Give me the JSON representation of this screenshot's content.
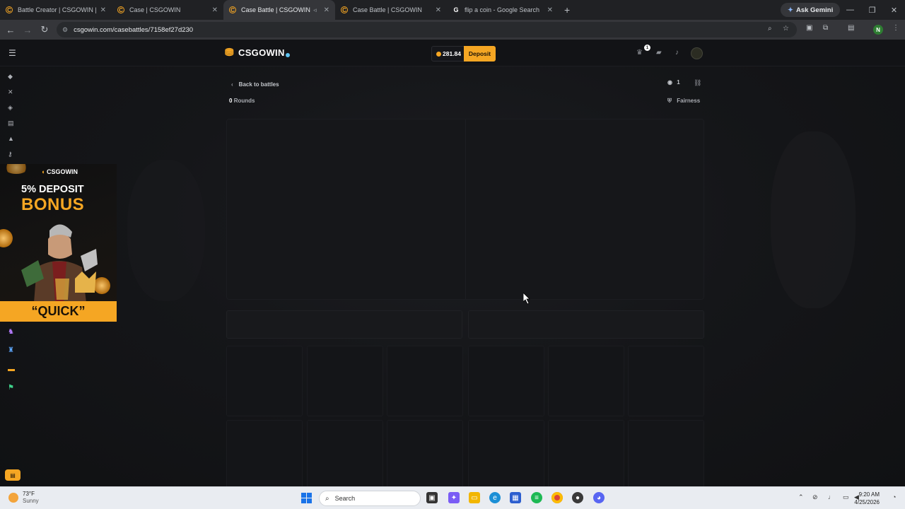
{
  "browser": {
    "tabs": [
      {
        "title": "Battle Creator | CSGOWIN | De",
        "icon": "csgowin-icon",
        "active": false
      },
      {
        "title": "Case | CSGOWIN",
        "icon": "csgowin-icon",
        "active": false
      },
      {
        "title": "Case Battle | CSGOWIN",
        "icon": "csgowin-icon",
        "active": true
      },
      {
        "title": "Case Battle | CSGOWIN",
        "icon": "csgowin-icon",
        "active": false
      },
      {
        "title": "flip a coin - Google Search",
        "icon": "google-icon",
        "active": false
      }
    ],
    "ask_gemini": "Ask Gemini",
    "url": "csgowin.com/casebattles/7158ef27d230",
    "profile_initial": "N"
  },
  "site": {
    "logo_text": "CSGOWIN",
    "balance": "281.84",
    "deposit_label": "Deposit",
    "notification_count": "1"
  },
  "battle": {
    "back_label": "Back to battles",
    "viewers": "1",
    "rounds_count": "0",
    "rounds_label": "Rounds",
    "fairness_label": "Fairness"
  },
  "promo": {
    "logo_text": "CSGOWIN",
    "line1": "5% DEPOSIT",
    "line2": "BONUS",
    "line3": "“QUICK”"
  },
  "taskbar": {
    "temperature": "73°F",
    "condition": "Sunny",
    "search_placeholder": "Search",
    "time": "9:20 AM",
    "date": "4/25/2026"
  },
  "colors": {
    "accent": "#f5a623",
    "page_bg": "#111214"
  }
}
